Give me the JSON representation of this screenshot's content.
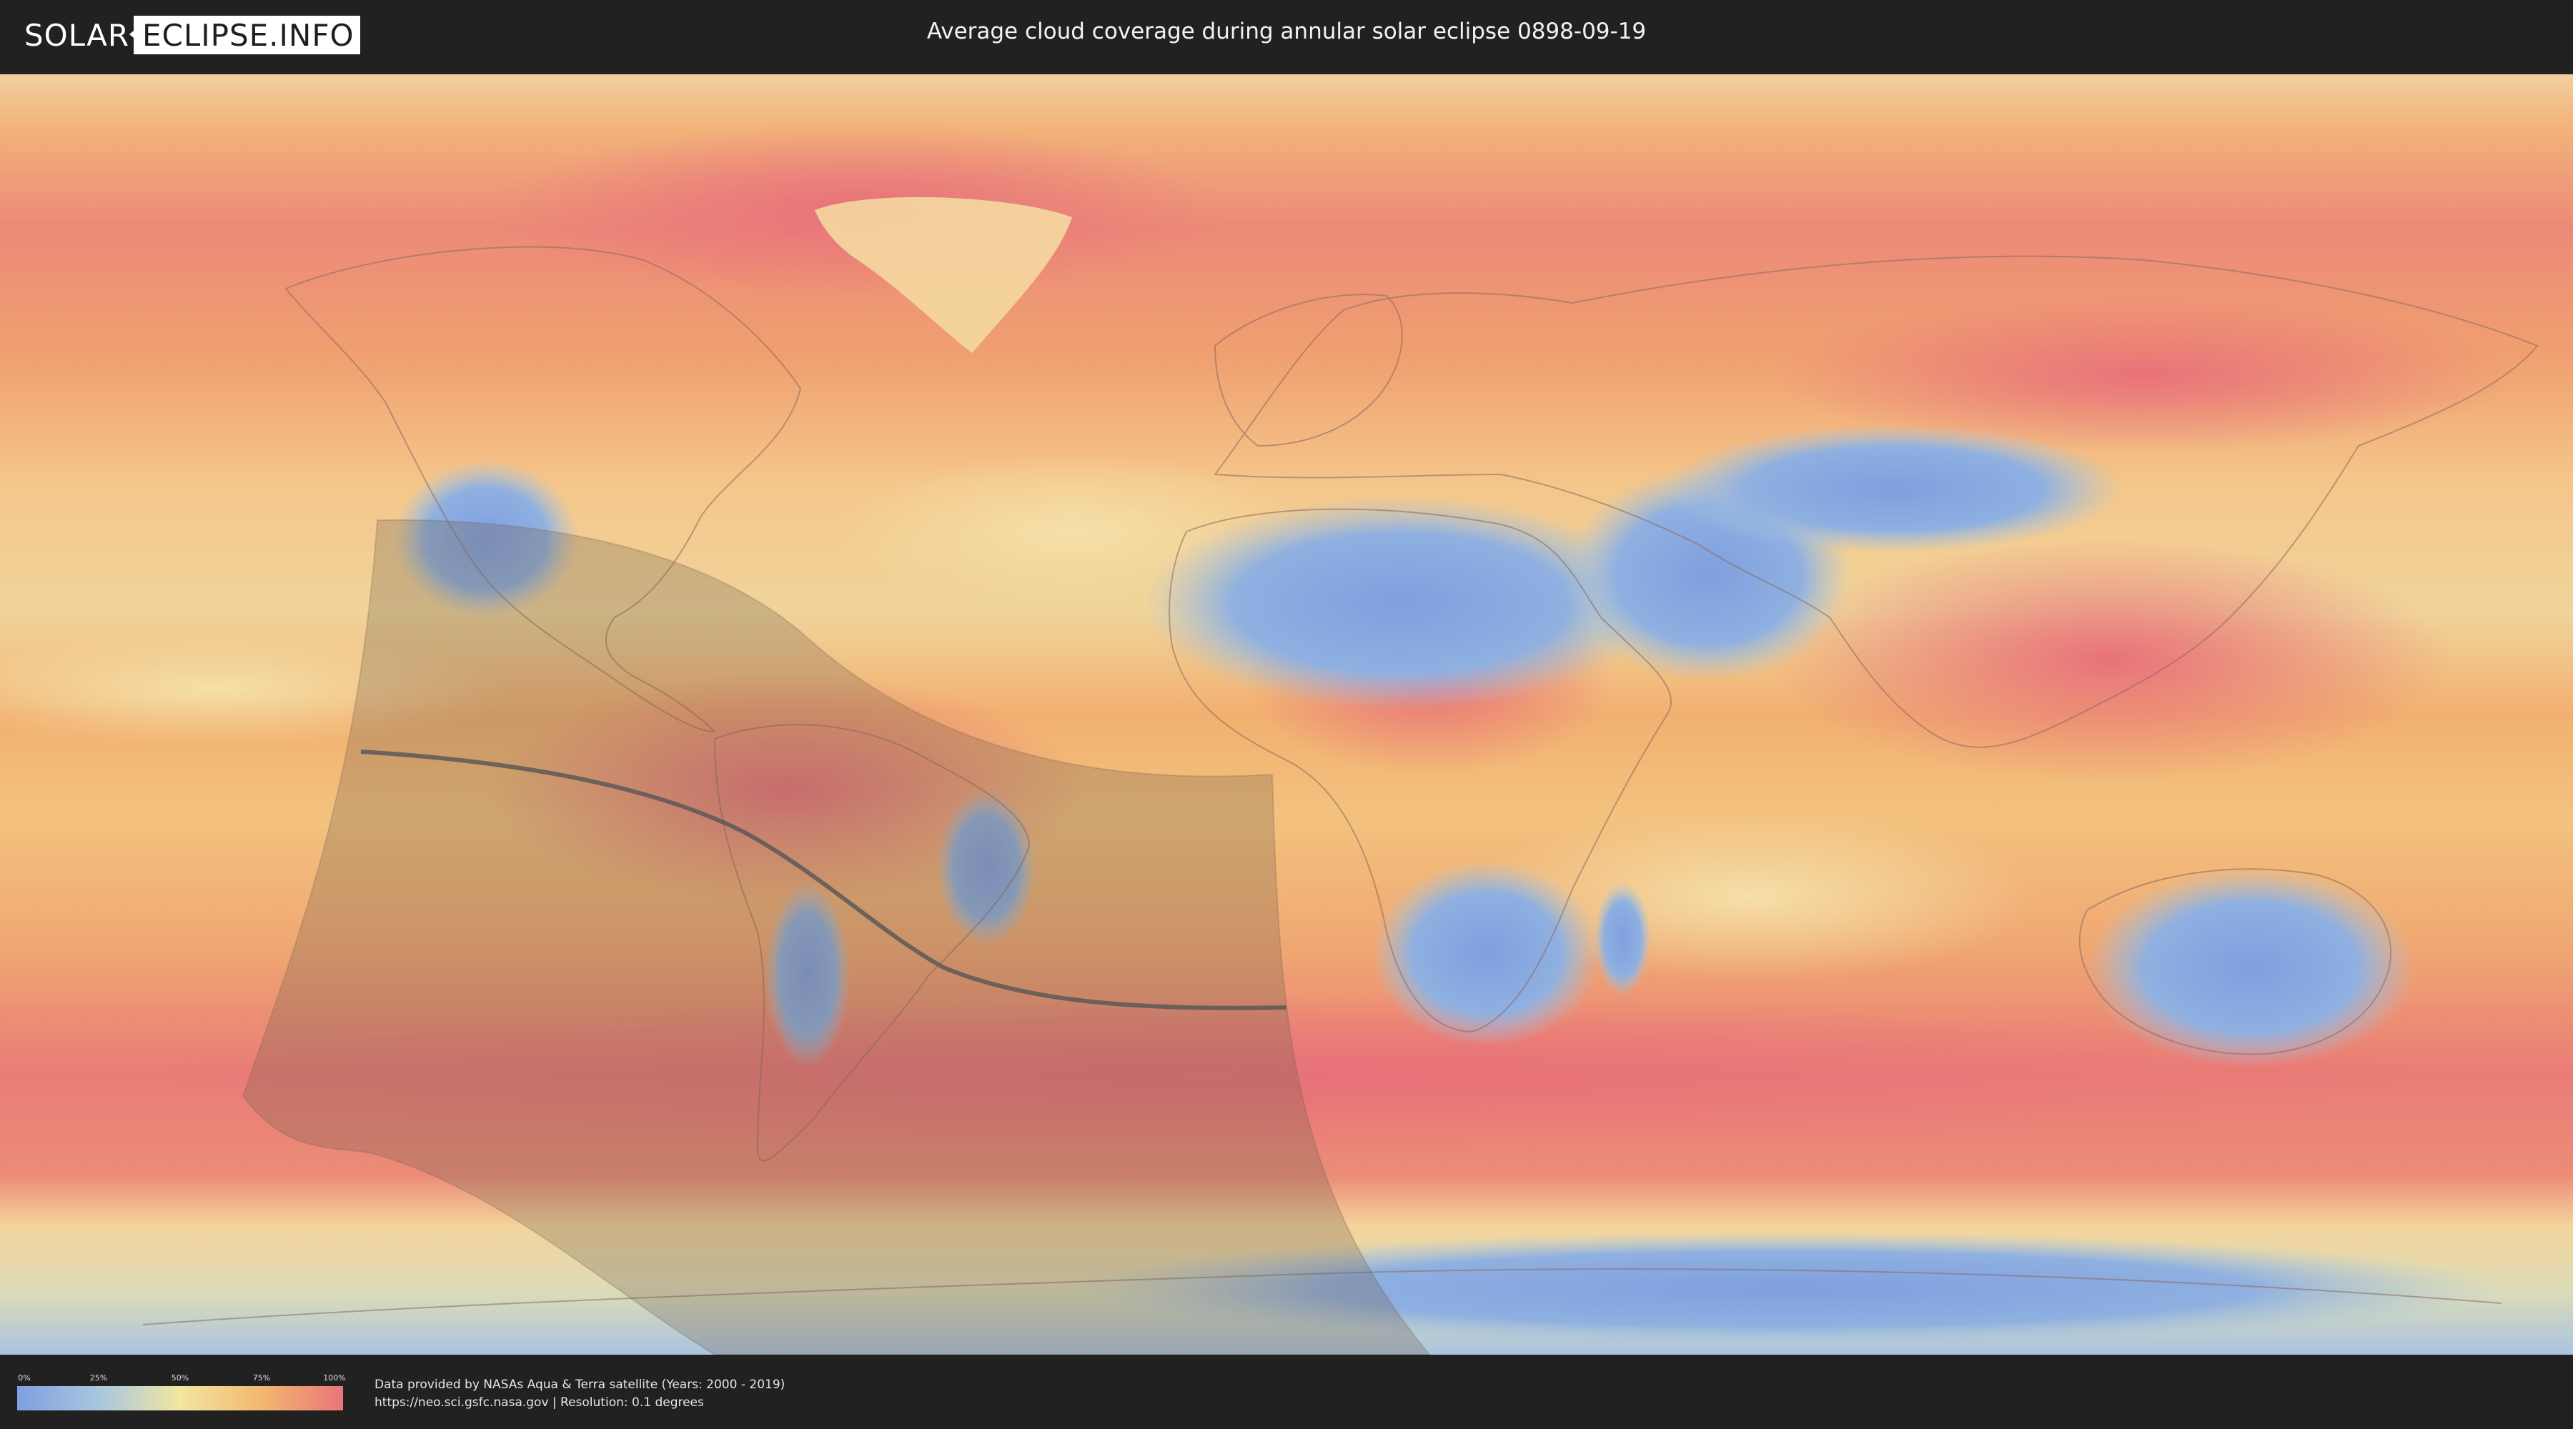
{
  "header": {
    "logo": {
      "part1": "SOLAR",
      "part2": "ECLIPSE.INFO"
    },
    "title": "Average cloud coverage during annular solar eclipse 0898-09-19"
  },
  "map": {
    "type": "cloud coverage world map (equirectangular)",
    "colors": {
      "ocean_base": "#f3b47a",
      "cloudy": "#e8767a",
      "clear": "#7f9fdf",
      "eclipse_overlay": "#6e5c4a",
      "path_line": "#555555"
    }
  },
  "legend": {
    "ticks": [
      "0%",
      "25%",
      "50%",
      "75%",
      "100%"
    ],
    "colors": [
      "#7f9fdf",
      "#a8c6df",
      "#f2e6a0",
      "#f2b870",
      "#e8767a"
    ]
  },
  "credits": {
    "line1": "Data provided by NASAs Aqua & Terra satellite (Years: 2000 - 2019)",
    "line2": "https://neo.sci.gsfc.nasa.gov | Resolution: 0.1 degrees"
  }
}
